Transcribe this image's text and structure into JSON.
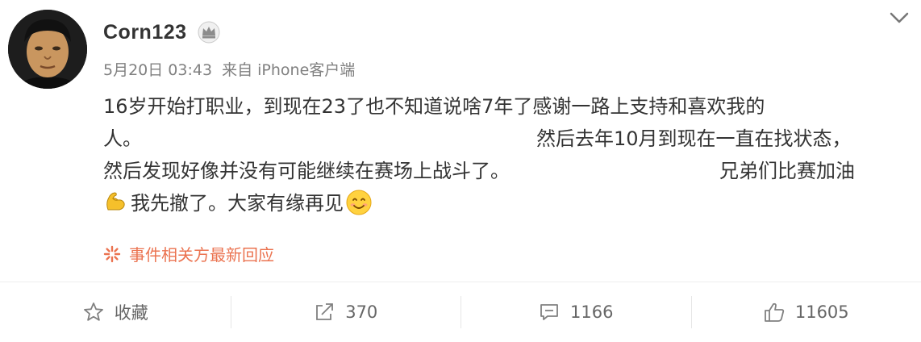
{
  "post": {
    "username": "Corn123",
    "date": "5月20日 03:43",
    "source": "来自 iPhone客户端",
    "text": {
      "line1": "16岁开始打职业，到现在23了也不知道说啥7年了感谢一路上支持和喜欢我的",
      "line2a": "人。",
      "line2b": "然后去年10月到现在一直在找状态，",
      "line3a": "然后发现好像并没有可能继续在赛场上战斗了。",
      "line3b": "兄弟们比赛加油",
      "line4": "我先撤了。大家有缘再见"
    },
    "event_link": "事件相关方最新回应",
    "icons": {
      "avatar": "user-avatar",
      "badge": "crown-badge-icon",
      "menu": "chevron-down-icon",
      "flex": "flexed-biceps-emoji",
      "smile": "smiling-face-emoji",
      "event": "sparkle-icon"
    }
  },
  "actions": {
    "favorite_label": "收藏",
    "repost_count": "370",
    "comment_count": "1166",
    "like_count": "11605"
  },
  "colors": {
    "text": "#333333",
    "meta": "#808080",
    "event_link": "#eb7350",
    "action_text": "#666666"
  }
}
